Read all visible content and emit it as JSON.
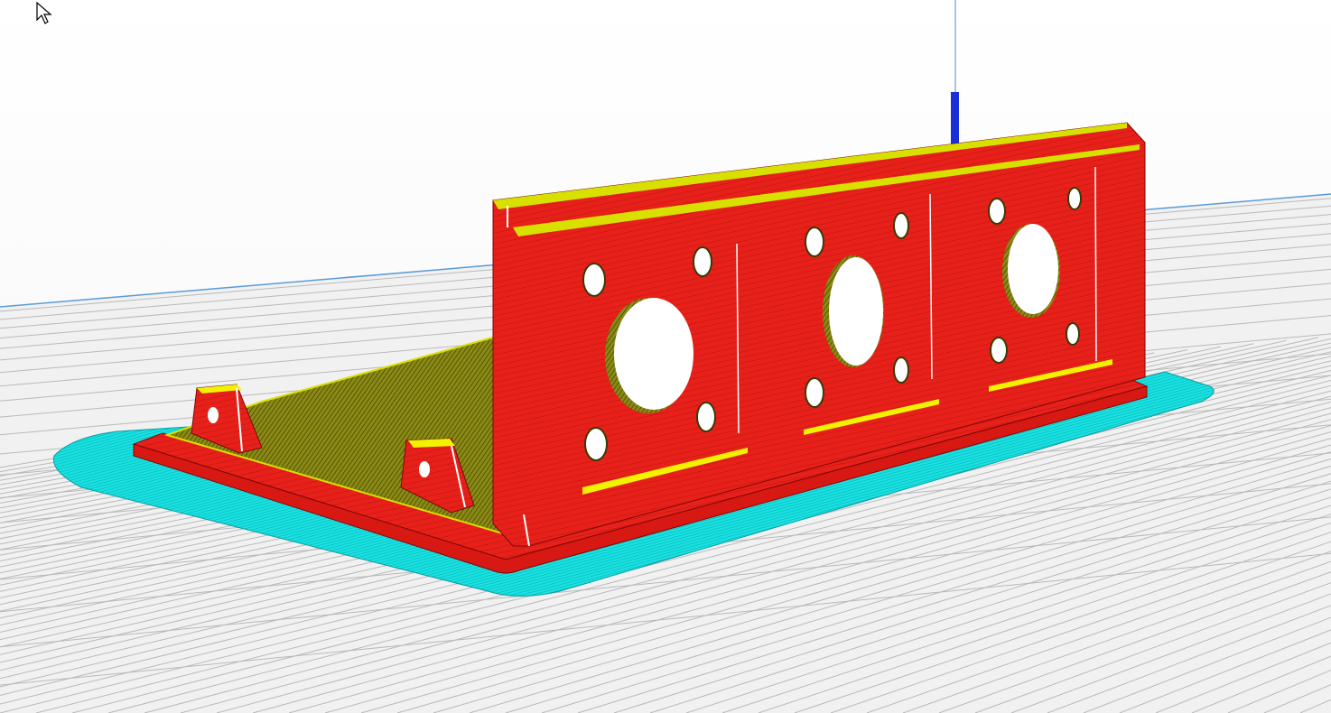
{
  "app": {
    "view": "layer-preview"
  },
  "colors": {
    "background": "#ffffff",
    "build_plate_grid": "#b8b8b8",
    "build_plate_fill": "#f0f0f0",
    "plate_edge": "#5a9bd8",
    "outer_wall": "#e8201a",
    "infill": "#7a7a10",
    "top_bottom": "#f2f200",
    "skirt_brim": "#16e0e0",
    "z_axis": "#1a2fd8"
  },
  "icons": {
    "cursor": "mouse-pointer-icon"
  }
}
